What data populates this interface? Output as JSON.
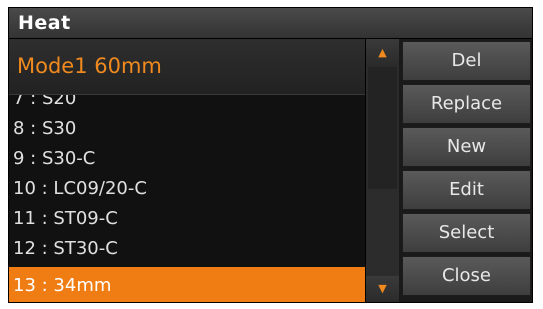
{
  "window": {
    "title": "Heat"
  },
  "mode": {
    "label": "Mode1 60mm"
  },
  "items": [
    {
      "label": "7 : S20"
    },
    {
      "label": "8 : S30"
    },
    {
      "label": "9 : S30-C"
    },
    {
      "label": "10 : LC09/20-C"
    },
    {
      "label": "11 : ST09-C"
    },
    {
      "label": "12 : ST30-C"
    },
    {
      "label": "13 : 34mm",
      "selected": true
    }
  ],
  "scrollbar": {
    "up_icon": "triangle-up",
    "down_icon": "triangle-down"
  },
  "buttons": {
    "del": "Del",
    "replace": "Replace",
    "new": "New",
    "edit": "Edit",
    "select": "Select",
    "close": "Close"
  },
  "colors": {
    "accent": "#f07c14",
    "mode_text": "#f08a1e",
    "background": "#111111"
  }
}
